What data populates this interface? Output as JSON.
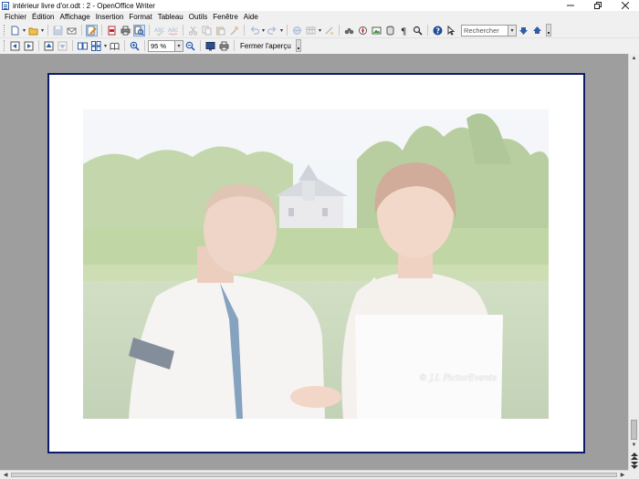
{
  "window": {
    "title": "intérieur livre d'or.odt : 2 - OpenOffice Writer",
    "controls": [
      "minimize",
      "restore",
      "close"
    ]
  },
  "menu": {
    "items": [
      "Fichier",
      "Édition",
      "Affichage",
      "Insertion",
      "Format",
      "Tableau",
      "Outils",
      "Fenêtre",
      "Aide"
    ]
  },
  "toolbar_standard": {
    "search_placeholder": "Rechercher"
  },
  "toolbar_preview": {
    "zoom_value": "95 %",
    "close_preview_label": "Fermer l'aperçu"
  },
  "document": {
    "photo_watermark": "© J.L PicturEvents",
    "page_border_color": "#0d1a6b"
  },
  "colors": {
    "workspace": "#9e9e9e",
    "ui_background": "#f0f0f0",
    "active_button": "#cfe3f7"
  }
}
